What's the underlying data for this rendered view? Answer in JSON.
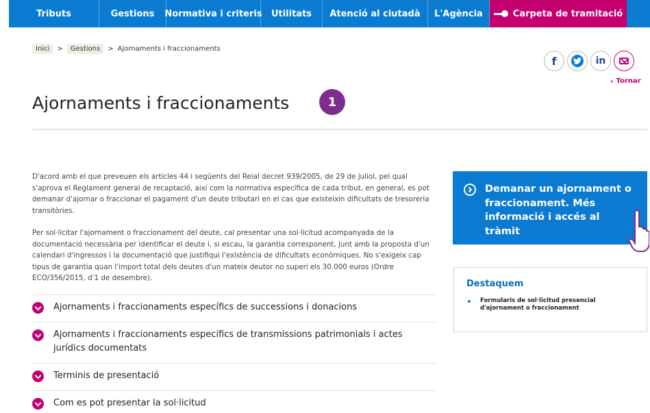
{
  "nav": {
    "items": [
      {
        "label": "Tributs"
      },
      {
        "label": "Gestions"
      },
      {
        "label": "Normativa i criteris"
      },
      {
        "label": "Utilitats"
      },
      {
        "label": "Atenció al ciutadà"
      },
      {
        "label": "L'Agència"
      }
    ],
    "carpeta_label": "Carpeta de tramitació"
  },
  "breadcrumb": {
    "home": "Inici",
    "section": "Gestions",
    "current": "Ajornaments i fraccionaments",
    "separator": ">"
  },
  "social": {
    "facebook": "f",
    "twitter": "t",
    "linkedin": "in"
  },
  "back_link": "Tornar",
  "page_title": "Ajornaments i fraccionaments",
  "step_badge": "1",
  "paragraphs": [
    "D'acord amb el que preveuen els articles 44 i següents del Reial decret 939/2005, de 29 de juliol, pel qual s'aprova el Reglament general de recaptació, així com la normativa específica de cada tribut, en general, es pot demanar d'ajornar o fraccionar el pagament d'un deute tributari en el cas que existeixin dificultats de tresoreria transitòries.",
    "Per sol·licitar l'ajornament o fraccionament del deute, cal presentar una sol·licitud acompanyada de la documentació necessària per identificar el deute i, si escau, la garantia corresponent, junt amb la proposta d'un calendari d'ingressos i la documentació que justifiqui l'existència de dificultats econòmiques. No s'exigeix cap tipus de garantia quan l'import total dels deutes d'un mateix deutor no superi els 30.000 euros (Ordre ECO/356/2015, d'1 de desembre)."
  ],
  "accordion": [
    {
      "label": "Ajornaments i fraccionaments específics de successions i donacions"
    },
    {
      "label": "Ajornaments i fraccionaments específics de transmissions patrimonials i actes jurídics documentats"
    },
    {
      "label": "Terminis de presentació"
    },
    {
      "label": "Com es pot presentar la sol·licitud"
    }
  ],
  "cta": {
    "label": "Demanar un ajornament o fraccionament. Més informació i accés al tràmit"
  },
  "highlights": {
    "title": "Destaquem",
    "items": [
      {
        "label": "Formularis de sol·licitud presencial d'ajornament o fraccionament"
      }
    ]
  },
  "colors": {
    "nav_blue": "#0a7bd0",
    "magenta": "#c4006e",
    "badge_purple": "#7e2d8f"
  }
}
